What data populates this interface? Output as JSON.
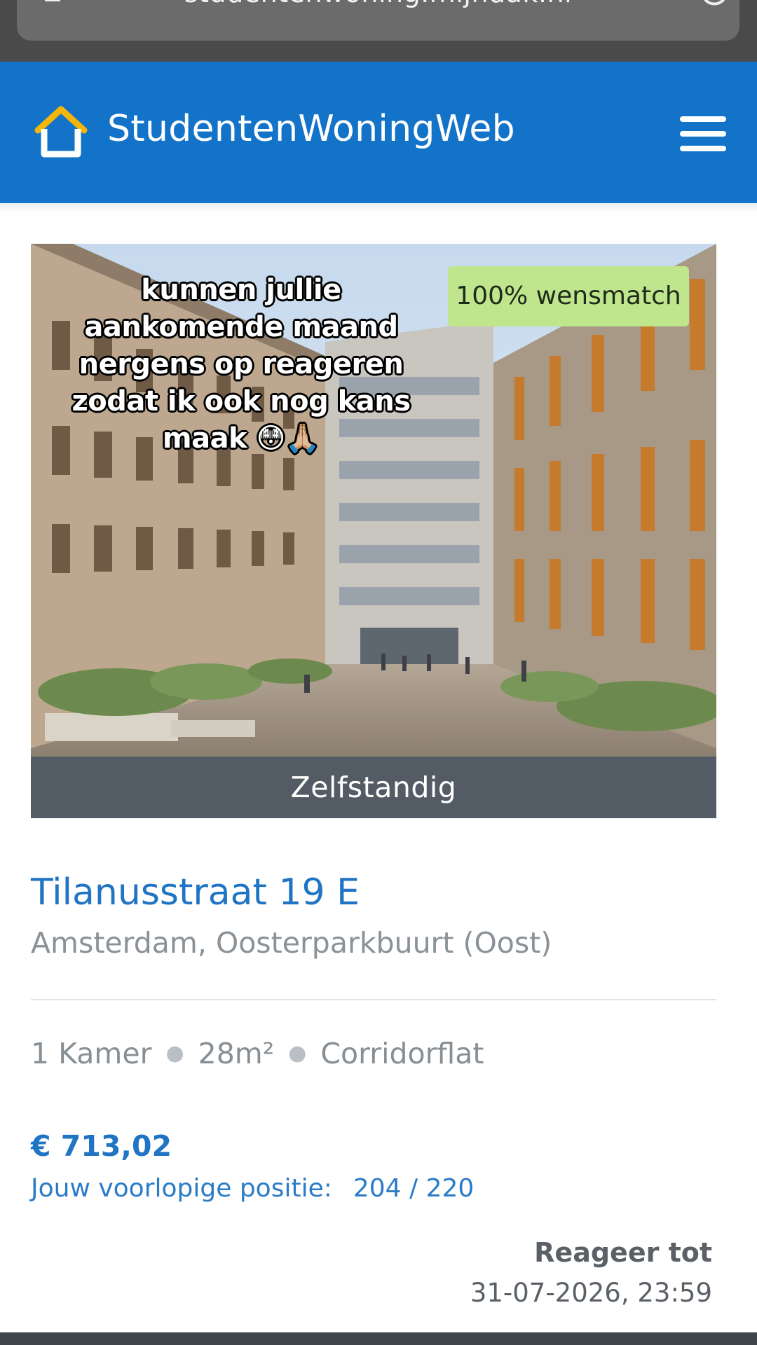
{
  "browser": {
    "url": "studentenwoning.mijndak.nl"
  },
  "header": {
    "logo_text": "StudentenWoningWeb",
    "logo_color": "#f5b50a",
    "background": "#1273c8"
  },
  "listing": {
    "overlay_caption": "kunnen jullie aankomende maand nergens op reageren zodat ik ook nog kans maak 😳🙏🏼",
    "match_badge": "100% wensmatch",
    "type": "Zelfstandig",
    "street": "Tilanusstraat 19 E",
    "city": "Amsterdam, Oosterparkbuurt (Oost)",
    "rooms": "1 Kamer",
    "size": "28m²",
    "building_type": "Corridorflat",
    "price": "€ 713,02",
    "position_label": "Jouw voorlopige positie:",
    "position_value": "204 / 220",
    "deadline_label": "Reageer tot",
    "deadline_value": "31-07-2026, 23:59",
    "accent_color": "#1f74c4",
    "badge_color": "#bfe68c"
  }
}
